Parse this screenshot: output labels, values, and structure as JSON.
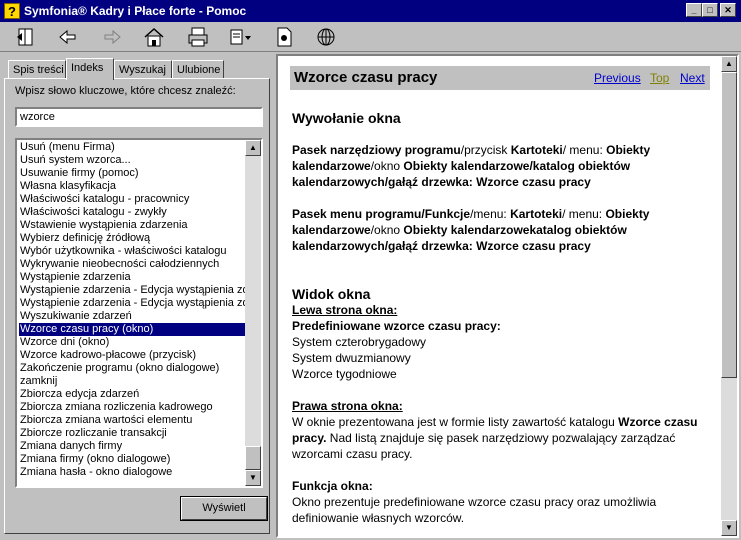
{
  "window": {
    "title": "Symfonia® Kadry i Płace forte  - Pomoc",
    "min_glyph": "_",
    "max_glyph": "□",
    "close_glyph": "✕"
  },
  "toolbar": [
    "hide-icon",
    "back-icon",
    "forward-icon",
    "home-icon",
    "print-icon",
    "options-icon",
    "notes-icon",
    "internet-icon"
  ],
  "tabs": [
    {
      "label": "Spis treści"
    },
    {
      "label": "Indeks"
    },
    {
      "label": "Wyszukaj"
    },
    {
      "label": "Ulubione"
    }
  ],
  "index": {
    "prompt": "Wpisz słowo kluczowe, które chcesz znaleźć:",
    "keyword_value": "wzorce",
    "items": [
      "Usuń (menu Firma)",
      "Usuń system wzorca...",
      "Usuwanie firmy (pomoc)",
      "Własna klasyfikacja",
      "Właściwości katalogu - pracownicy",
      "Właściwości katalogu - zwykły",
      "Wstawienie wystąpienia zdarzenia",
      "Wybierz definicję źródłową",
      "Wybór użytkownika - właściwości katalogu",
      "Wykrywanie nieobecności całodziennych",
      "Wystąpienie zdarzenia",
      "Wystąpienie zdarzenia - Edycja wystąpienia zdarzenia",
      "Wystąpienie zdarzenia - Edycja wystąpienia zdarzenia",
      "Wyszukiwanie zdarzeń",
      "Wzorce czasu pracy (okno)",
      "Wzorce dni (okno)",
      "Wzorce kadrowo-płacowe (przycisk)",
      "Zakończenie programu (okno dialogowe)",
      "zamknij",
      "Zbiorcza edycja zdarzeń",
      "Zbiorcza zmiana rozliczenia kadrowego",
      "Zbiorcza zmiana wartości elementu",
      "Zbiorcze rozliczanie transakcji",
      "Zmiana danych firmy",
      "Zmiana firmy (okno dialogowe)",
      "Zmiana hasła - okno dialogowe"
    ],
    "selected_index": 14,
    "show_button": "Wyświetl",
    "scroll_up": "▲",
    "scroll_down": "▼"
  },
  "topic": {
    "title": "Wzorce czasu pracy",
    "nav": {
      "previous": "Previous",
      "top": "Top",
      "next": "Next"
    },
    "link_color": "#0000cc",
    "top_color": "#808000",
    "section1_heading": "Wywołanie okna",
    "p1_a": "Pasek narzędziowy programu",
    "p1_b": "/przycisk ",
    "p1_c": "Kartoteki",
    "p1_d": "/ menu: ",
    "p1_e": "Obiekty kalendarzowe",
    "p1_f": "/okno ",
    "p1_g": "Obiekty kalendarzowe/katalog obiektów kalendarzowych/gałąź drzewka: Wzorce czasu pracy",
    "p2_a": "Pasek menu programu/Funkcje",
    "p2_b": "/menu: ",
    "p2_c": "Kartoteki",
    "p2_d": "/ menu: ",
    "p2_e": "Obiekty kalendarzowe",
    "p2_f": "/okno ",
    "p2_g": "Obiekty kalendarzowekatalog obiektów kalendarzowych/gałąź drzewka: Wzorce czasu pracy",
    "section2_heading": "Widok okna",
    "left_side": "Lewa strona okna:",
    "predefined": "Predefiniowane wzorce czasu pracy:",
    "patterns": [
      "System czterobrygadowy",
      "System dwuzmianowy",
      "Wzorce tygodniowe"
    ],
    "right_side": "Prawa strona okna:",
    "rp_a": "W oknie prezentowana jest w formie listy zawartość katalogu ",
    "rp_b": "Wzorce czasu pracy.",
    "rp_c": " Nad listą znajduje się pasek narzędziowy pozwalający zarządzać wzorcami czasu pracy.",
    "function_heading": "Funkcja okna:",
    "function_text": "Okno prezentuje predefiniowane wzorce czasu pracy oraz umożliwia definiowanie własnych wzorców."
  }
}
